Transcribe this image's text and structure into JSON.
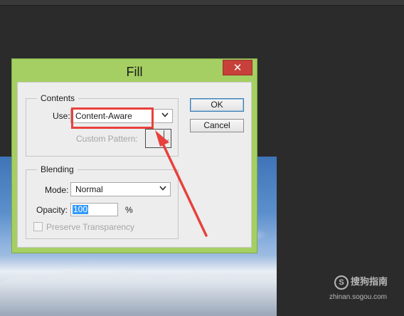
{
  "dialog": {
    "title": "Fill",
    "close_glyph": "✕",
    "ok_label": "OK",
    "cancel_label": "Cancel"
  },
  "contents": {
    "legend": "Contents",
    "use_label": "Use:",
    "use_value": "Content-Aware",
    "custom_pattern_label": "Custom Pattern:"
  },
  "blending": {
    "legend": "Blending",
    "mode_label": "Mode:",
    "mode_value": "Normal",
    "opacity_label": "Opacity:",
    "opacity_value": "100",
    "opacity_unit": "%",
    "preserve_label": "Preserve Transparency"
  },
  "watermark": {
    "brand": "搜狗指南",
    "logo_char": "S",
    "url": "zhinan.sogou.com"
  },
  "colors": {
    "title_bar": "#a5cf63",
    "close_button": "#c7413a",
    "annotation": "#e8413c"
  },
  "icons": [
    "close-icon",
    "chevron-down-icon",
    "pattern-swatch-icon",
    "annotation-arrow-icon"
  ]
}
